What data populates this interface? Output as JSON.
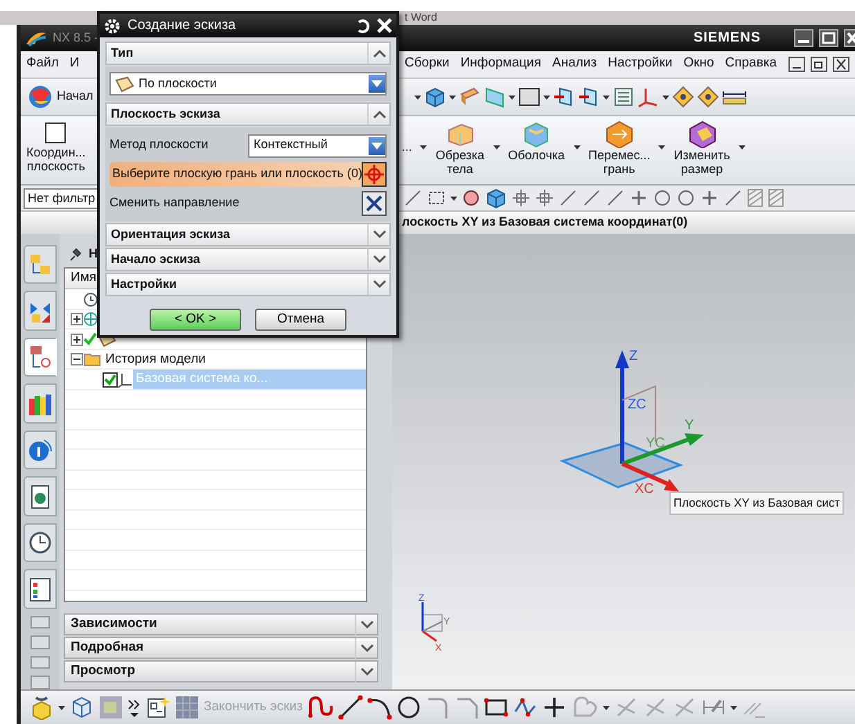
{
  "background_window": {
    "title": "t Word"
  },
  "window": {
    "title": "NX 8.5 -",
    "brand": "SIEMENS"
  },
  "menu": {
    "left": [
      "Файл",
      "И"
    ],
    "right": [
      "Сборки",
      "Информация",
      "Анализ",
      "Настройки",
      "Окно",
      "Справка"
    ]
  },
  "start_button": {
    "label": "Начал"
  },
  "ribbon": {
    "left": [
      {
        "kind": "plane",
        "lines": [
          "Координ...",
          "плоскость"
        ]
      }
    ],
    "right": [
      {
        "kind": "none",
        "lines": [
          "..."
        ]
      },
      {
        "kind": "trim",
        "lines": [
          "Обрезка",
          "тела"
        ]
      },
      {
        "kind": "shell",
        "lines": [
          "Оболочка"
        ]
      },
      {
        "kind": "move",
        "lines": [
          "Перемес...",
          "грань"
        ]
      },
      {
        "kind": "resize",
        "lines": [
          "Изменить",
          "размер"
        ]
      }
    ]
  },
  "filter": {
    "value": "Нет фильтр"
  },
  "cue_line": "лоскость XY из Базовая система координат(0)",
  "resource_tabs": [
    {
      "kind": "assembly",
      "selected": false
    },
    {
      "kind": "constraints",
      "selected": false
    },
    {
      "kind": "part",
      "selected": true
    },
    {
      "kind": "library",
      "selected": false
    },
    {
      "kind": "info",
      "selected": false
    },
    {
      "kind": "document",
      "selected": false
    },
    {
      "kind": "history",
      "selected": false
    },
    {
      "kind": "roles",
      "selected": false
    }
  ],
  "navigator": {
    "title": "Н",
    "column": "Имя",
    "tree": [
      {
        "kind": "timestamp"
      },
      {
        "kind": "datum",
        "expanded": false
      },
      {
        "kind": "cameras",
        "expanded": false,
        "checked": true
      },
      {
        "kind": "folder",
        "label": "История модели",
        "expanded": true,
        "children": [
          {
            "kind": "csys",
            "label": "Базовая система ко...",
            "checked": true,
            "selected": true
          }
        ]
      }
    ],
    "sections": [
      {
        "label": "Зависимости",
        "expanded": false
      },
      {
        "label": "Подробная",
        "expanded": false
      },
      {
        "label": "Просмотр",
        "expanded": false
      }
    ]
  },
  "dialog": {
    "title": "Создание эскиза",
    "groups": [
      {
        "kind": "type",
        "title": "Тип",
        "expanded": true,
        "value": "По плоскости"
      },
      {
        "kind": "plane",
        "title": "Плоскость эскиза",
        "expanded": true,
        "method_label": "Метод плоскости",
        "method_value": "Контекстный",
        "select_prompt": "Выберите плоскую грань или плоскость (0)",
        "select_active": true,
        "reverse_label": "Сменить направление"
      },
      {
        "title": "Ориентация эскиза",
        "expanded": false
      },
      {
        "title": "Начало эскиза",
        "expanded": false
      },
      {
        "title": "Настройки",
        "expanded": false
      }
    ],
    "buttons": [
      {
        "label": "< OK >",
        "kind": "primary"
      },
      {
        "label": "Отмена",
        "kind": "secondary"
      }
    ]
  },
  "graphics": {
    "axis_labels": [
      "Z",
      "ZC",
      "Y",
      "YC",
      "XC"
    ],
    "tooltip": "Плоскость XY из Базовая сист",
    "triad_labels": [
      "Z",
      "Y",
      "X"
    ]
  },
  "sketch_toolbar": {
    "finish": {
      "label": "Закончить эскиз",
      "disabled": true
    }
  }
}
